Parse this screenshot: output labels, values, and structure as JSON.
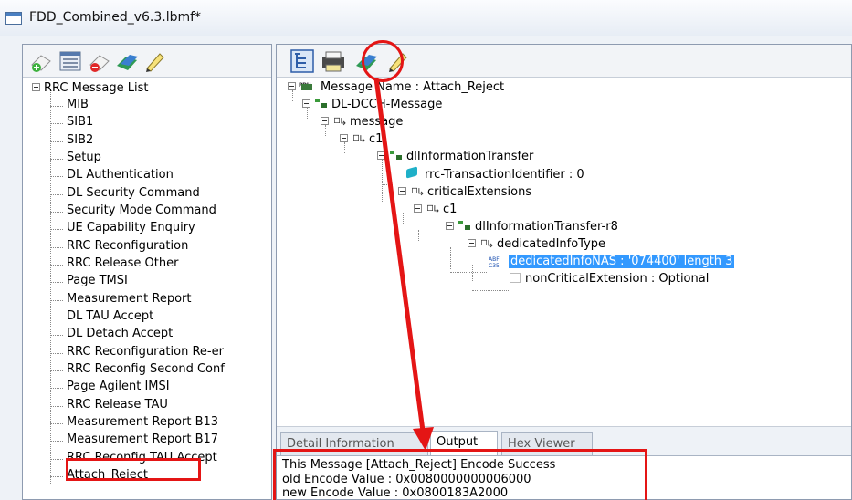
{
  "window": {
    "title": "FDD_Combined_v6.3.lbmf*"
  },
  "left_toolbar": {
    "buttons": [
      "new-icon",
      "list-icon",
      "delete-icon",
      "encode-icon",
      "edit-icon"
    ]
  },
  "message_list": {
    "root_label": "RRC Message List",
    "items": [
      "MIB",
      "SIB1",
      "SIB2",
      "Setup",
      "DL Authentication",
      "DL Security Command",
      "Security Mode Command",
      "UE Capability Enquiry",
      "RRC Reconfiguration",
      "RRC Release Other",
      "Page TMSI",
      "Measurement Report",
      "DL TAU Accept",
      "DL Detach Accept",
      "RRC Reconfiguration Re-er",
      "RRC Reconfig Second Conf",
      "Page Agilent IMSI",
      "RRC Release TAU",
      "Measurement Report B13",
      "Measurement Report B17",
      "RRC Reconfig TAU Accept",
      "Attach_Reject"
    ],
    "selected": "Attach_Reject"
  },
  "right_toolbar": {
    "buttons": [
      "tree-view-icon",
      "print-icon",
      "encode-icon",
      "edit-icon"
    ]
  },
  "message_tree": {
    "nodes": [
      "Message Name : Attach_Reject",
      "DL-DCCH-Message",
      "message",
      "c1",
      "dlInformationTransfer",
      "rrc-TransactionIdentifier : 0",
      "criticalExtensions",
      "c1",
      "dlInformationTransfer-r8",
      "dedicatedInfoType",
      "dedicatedInfoNAS : '074400' length 3",
      "nonCriticalExtension : Optional"
    ]
  },
  "tabs": {
    "labels": [
      "Detail Information",
      "Output",
      "Hex Viewer"
    ],
    "active": "Output"
  },
  "output": {
    "lines": [
      "This Message [Attach_Reject] Encode Success",
      "old Encode Value : 0x0080000000006000",
      "new Encode Value : 0x0800183A2000"
    ]
  },
  "colors": {
    "annotation": "#e41515",
    "selection": "#3399ff"
  }
}
